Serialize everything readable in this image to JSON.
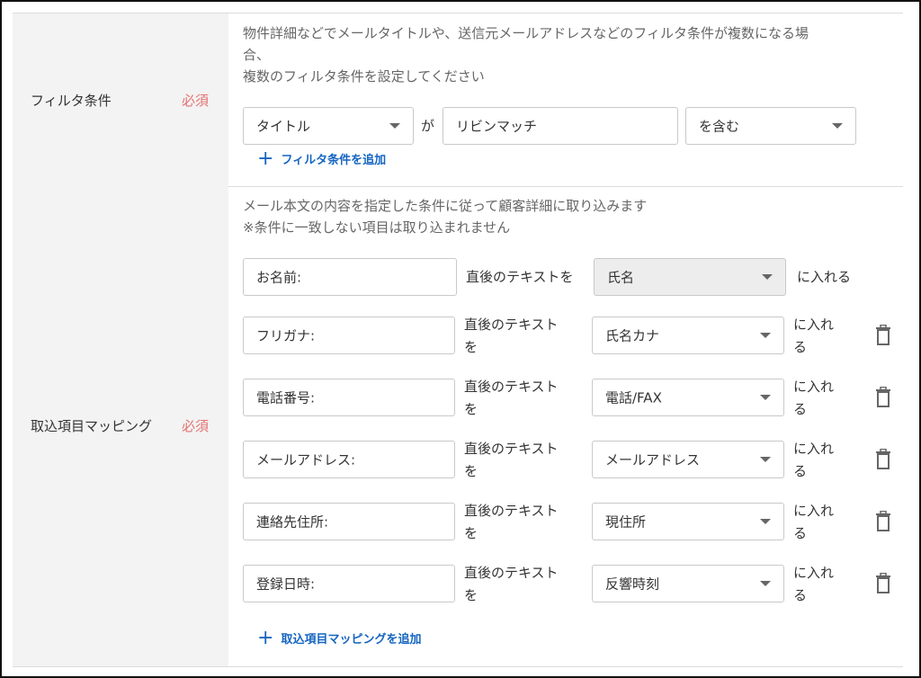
{
  "filter": {
    "label": "フィルタ条件",
    "required": "必須",
    "desc_line1": "物件詳細などでメールタイトルや、送信元メールアドレスなどのフィルタ条件が複数になる場",
    "desc_line2": "合、",
    "desc_line3": "複数のフィルタ条件を設定してください",
    "field_select": "タイトル",
    "connector": "が",
    "keyword": "リビンマッチ",
    "condition_select": "を含む",
    "add_label": "フィルタ条件を追加"
  },
  "mapping": {
    "label": "取込項目マッピング",
    "required": "必須",
    "desc_line1": "メール本文の内容を指定した条件に従って顧客詳細に取り込みます",
    "desc_line2": "※条件に一致しない項目は取り込まれません",
    "after_text_full": "直後のテキストを",
    "after_text_a": "直後のテキスト",
    "after_text_b": "を",
    "into_full": "に入れる",
    "into_a": "に入れ",
    "into_b": "る",
    "rows": [
      {
        "key": "お名前:",
        "target": "氏名"
      },
      {
        "key": "フリガナ:",
        "target": "氏名カナ"
      },
      {
        "key": "電話番号:",
        "target": "電話/FAX"
      },
      {
        "key": "メールアドレス:",
        "target": "メールアドレス"
      },
      {
        "key": "連絡先住所:",
        "target": "現住所"
      },
      {
        "key": "登録日時:",
        "target": "反響時刻"
      }
    ],
    "add_label": "取込項目マッピングを追加"
  },
  "icons": {
    "caret": "caret-down-icon",
    "plus": "plus-icon",
    "trash": "trash-icon"
  },
  "colors": {
    "required": "#e57373",
    "link": "#1565c0",
    "label_bg": "#f3f3f3"
  }
}
